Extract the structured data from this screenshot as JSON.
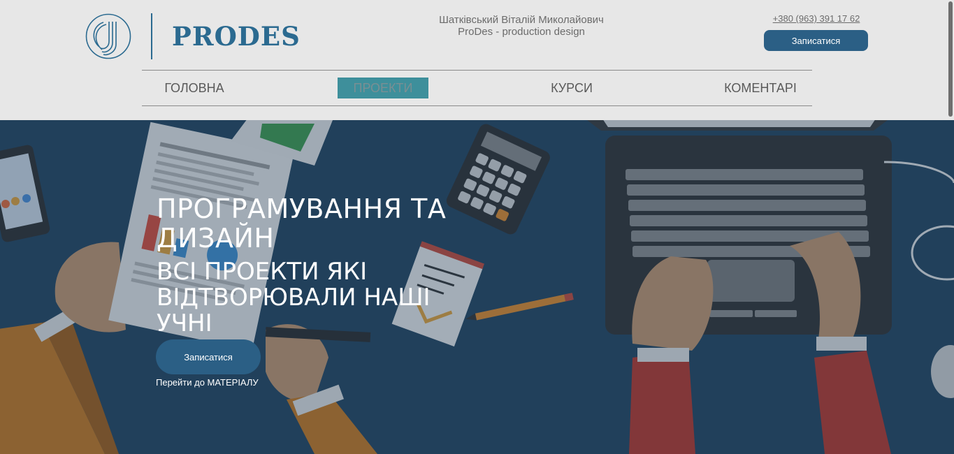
{
  "brand": {
    "logo_text": "PRODES"
  },
  "header": {
    "owner_name": "Шатківський Віталій Миколайович",
    "owner_tagline": "ProDes - production design",
    "phone": "+380 (963) 391 17 62",
    "signup_label": "Записатися"
  },
  "nav": {
    "items": [
      {
        "label": "ГОЛОВНА",
        "active": false
      },
      {
        "label": "ПРОЕКТИ",
        "active": true
      },
      {
        "label": "КУРСИ",
        "active": false
      },
      {
        "label": "КОМЕНТАРІ",
        "active": false
      }
    ]
  },
  "hero": {
    "title": "ПРОГРАМУВАННЯ ТА ДИЗАЙН",
    "subtitle": "ВСІ ПРОЕКТИ ЯКІ ВІДТВОРЮВАЛИ НАШІ УЧНІ",
    "button_label": "Записатися",
    "link_label": "Перейти до МАТЕРІАЛУ"
  },
  "colors": {
    "brand": "#2b6a90",
    "button": "#2b5f85",
    "active_nav": "#3e8f9b",
    "header_bg": "#e7e7e7",
    "hero_bg": "#24445f"
  }
}
